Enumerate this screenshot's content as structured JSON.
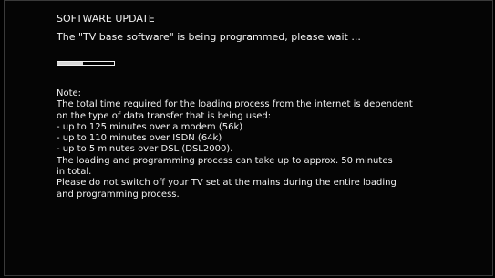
{
  "update": {
    "title": "SOFTWARE UPDATE",
    "status": "The \"TV base software\" is being programmed, please wait ...",
    "progress": 0.45
  },
  "note": {
    "heading": "Note:",
    "lines": [
      "The total time required for the loading process from the internet is dependent",
      "on the type of data transfer that is being used:",
      "- up to 125 minutes over a modem (56k)",
      "- up to 110 minutes over ISDN (64k)",
      "- up to 5 minutes over DSL (DSL2000).",
      "The loading and programming process can take up to approx. 50 minutes",
      "in total.",
      "Please do not switch off your TV set at the mains during the entire loading",
      "and programming process."
    ]
  },
  "colors": {
    "background": "#000000",
    "text": "#f2f2f2",
    "progress_fill": "#d8d8d8",
    "progress_border": "#f0f0f0"
  }
}
